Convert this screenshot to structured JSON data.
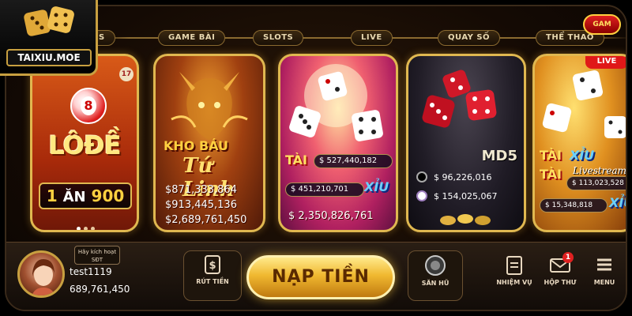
{
  "brand": {
    "logo_text": "TAIXIU.MOE"
  },
  "tabs": [
    {
      "label": "S"
    },
    {
      "label": "GAME BÀI"
    },
    {
      "label": "SLOTS"
    },
    {
      "label": "LIVE"
    },
    {
      "label": "QUAY SỐ"
    },
    {
      "label": "THỂ THAO"
    }
  ],
  "corner_badge": "GAM",
  "cards": {
    "lode": {
      "ball_number": "8",
      "corner_number": "17",
      "title": "LÔĐỀ",
      "odds_prefix": "1",
      "odds_word": "ĂN",
      "odds_value": "900"
    },
    "kho_bau": {
      "title": "KHO BÁU",
      "subtitle": "Tứ Linh",
      "jackpots": [
        "$871,333,864",
        "$913,445,136",
        "$2,689,761,450"
      ]
    },
    "taixiu": {
      "tai_label": "TÀI",
      "xiu_label": "XỈU",
      "tai_value": "$ 527,440,182",
      "xiu_value": "$ 451,210,701",
      "total": "$ 2,350,826,761"
    },
    "md5": {
      "label": "MD5",
      "black_value": "$ 96,226,016",
      "white_value": "$ 154,025,067"
    },
    "live": {
      "badge": "LIVE",
      "tai_label": "TÀI",
      "xiu_label": "XỈU",
      "livestream": "Livestream",
      "tai_value": "$ 113,023,528",
      "xiu_value": "$ 15,348,818"
    }
  },
  "bottom": {
    "activate_line1": "Hãy kích hoạt",
    "activate_line2": "SĐT",
    "username": "test1119",
    "balance": "689,761,450",
    "withdraw_label": "RÚT TIỀN",
    "deposit_label": "NẠP TIỀN",
    "jackpot_label": "SĂN HŨ",
    "missions_label": "NHIỆM VỤ",
    "mailbox_label": "HỘP THƯ",
    "mail_count": "1",
    "menu_label": "MENU"
  }
}
